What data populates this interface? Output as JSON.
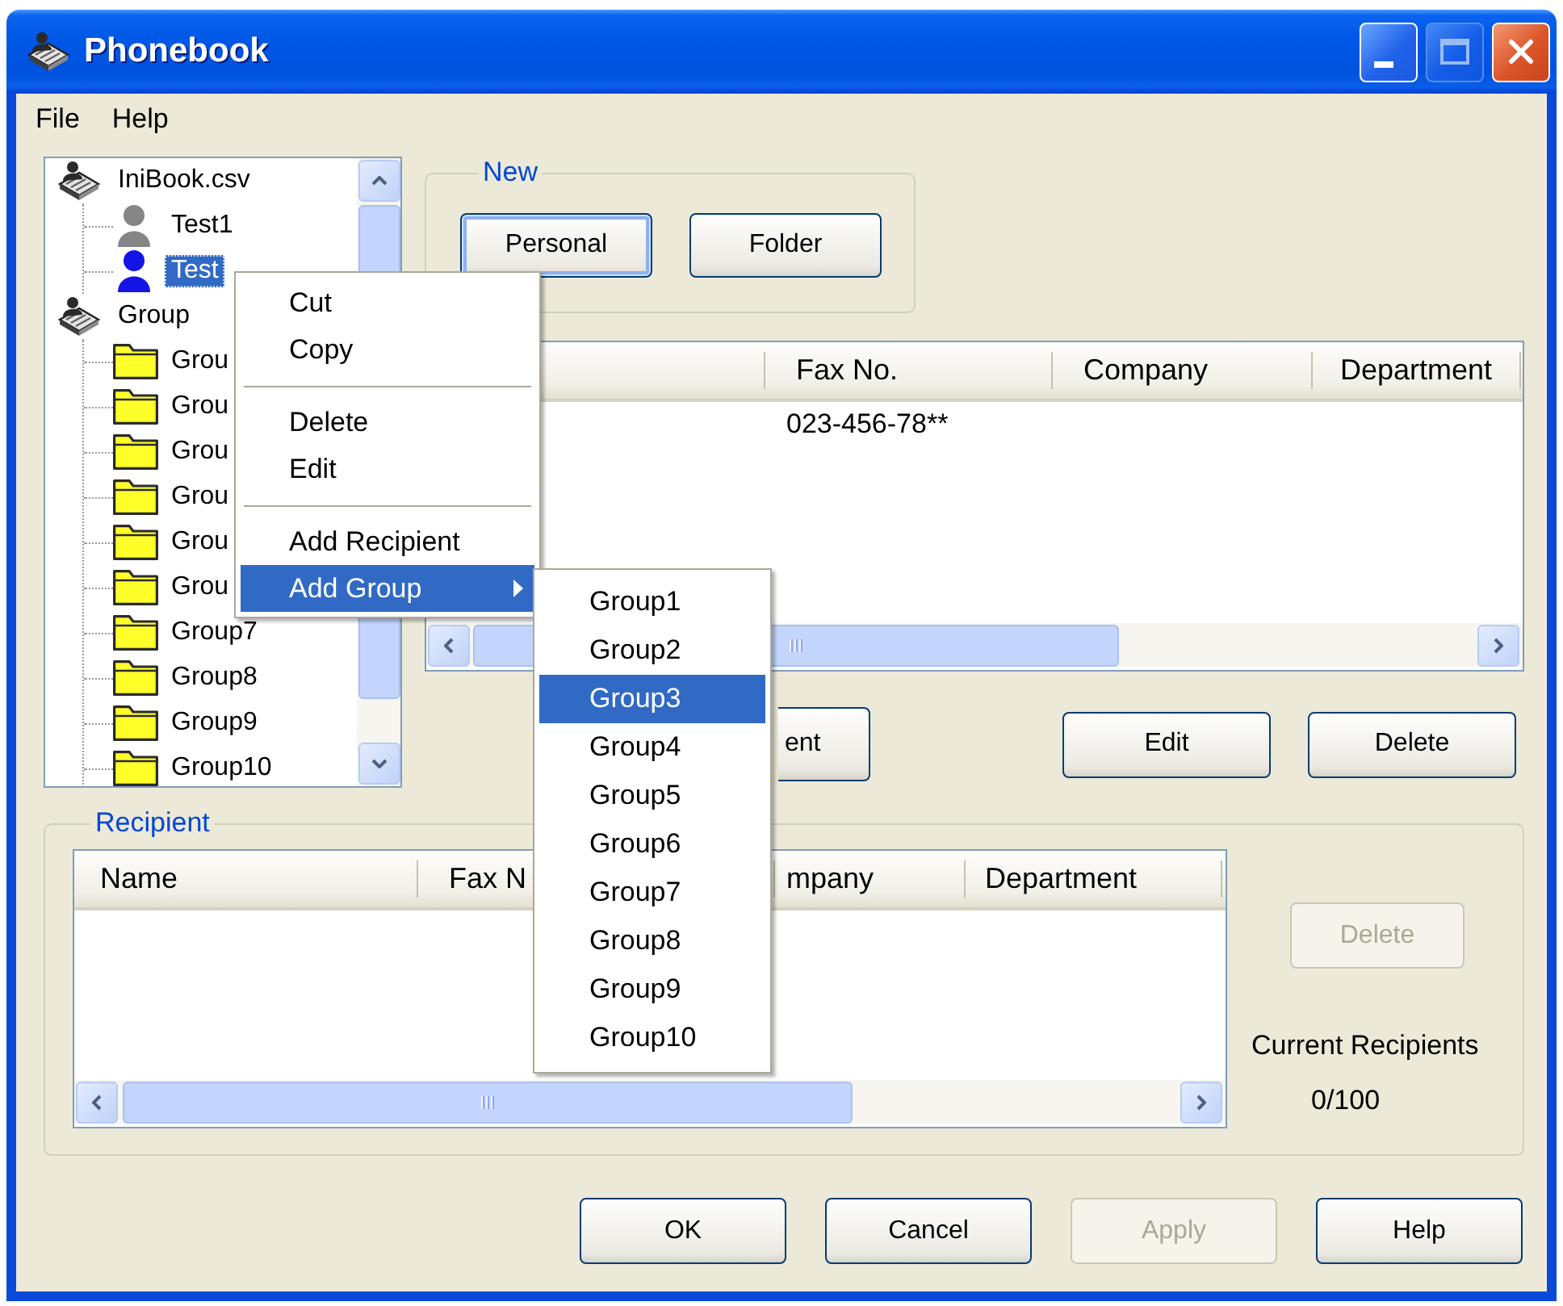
{
  "window": {
    "title": "Phonebook",
    "controls": [
      {
        "kind": "minimize",
        "disabled": false
      },
      {
        "kind": "maximize",
        "disabled": true
      },
      {
        "kind": "close",
        "disabled": false
      }
    ]
  },
  "menu": [
    "File",
    "Help"
  ],
  "tree": {
    "nodes": [
      {
        "kind": "book",
        "label": "IniBook.csv",
        "selected": false,
        "children": [
          {
            "kind": "person",
            "label": "Test1",
            "selected": false
          },
          {
            "kind": "person",
            "label": "Test",
            "selected": true
          }
        ]
      },
      {
        "kind": "book",
        "label": "Group",
        "selected": false,
        "children": [
          {
            "kind": "folder",
            "label": "Grou",
            "selected": false
          },
          {
            "kind": "folder",
            "label": "Grou",
            "selected": false
          },
          {
            "kind": "folder",
            "label": "Grou",
            "selected": false
          },
          {
            "kind": "folder",
            "label": "Grou",
            "selected": false
          },
          {
            "kind": "folder",
            "label": "Grou",
            "selected": false
          },
          {
            "kind": "folder",
            "label": "Grou",
            "selected": false
          },
          {
            "kind": "folder",
            "label": "Group7",
            "selected": false
          },
          {
            "kind": "folder",
            "label": "Group8",
            "selected": false
          },
          {
            "kind": "folder",
            "label": "Group9",
            "selected": false
          },
          {
            "kind": "folder",
            "label": "Group10",
            "selected": false
          }
        ]
      }
    ]
  },
  "new_group": {
    "title": "New",
    "buttons": [
      {
        "label": "Personal",
        "focused": true
      },
      {
        "label": "Folder",
        "focused": false
      }
    ]
  },
  "address_list": {
    "columns": [
      "Fax No.",
      "Company",
      "Department"
    ],
    "rows": [
      {
        "cells": [
          "023-456-78**"
        ]
      }
    ]
  },
  "list_buttons": [
    {
      "label": "ent"
    },
    {
      "label": "Edit"
    },
    {
      "label": "Delete"
    }
  ],
  "recipient": {
    "title": "Recipient",
    "columns": [
      "Name",
      "Fax N",
      "mpany",
      "Department"
    ],
    "delete_button": {
      "label": "Delete",
      "disabled": true
    },
    "count_label": "Current Recipients",
    "count": "0/100"
  },
  "dialog_buttons": [
    {
      "label": "OK",
      "disabled": false
    },
    {
      "label": "Cancel",
      "disabled": false
    },
    {
      "label": "Apply",
      "disabled": true
    },
    {
      "label": "Help",
      "disabled": false
    }
  ],
  "context_menu": {
    "items": [
      {
        "kind": "item",
        "label": "Cut",
        "selected": false
      },
      {
        "kind": "item",
        "label": "Copy",
        "selected": false
      },
      {
        "kind": "separator"
      },
      {
        "kind": "item",
        "label": "Delete",
        "selected": false
      },
      {
        "kind": "item",
        "label": "Edit",
        "selected": false
      },
      {
        "kind": "separator"
      },
      {
        "kind": "item",
        "label": "Add Recipient",
        "selected": false
      },
      {
        "kind": "submenu",
        "label": "Add Group",
        "selected": true,
        "submenu": [
          {
            "label": "Group1",
            "selected": false
          },
          {
            "label": "Group2",
            "selected": false
          },
          {
            "label": "Group3",
            "selected": true
          },
          {
            "label": "Group4",
            "selected": false
          },
          {
            "label": "Group5",
            "selected": false
          },
          {
            "label": "Group6",
            "selected": false
          },
          {
            "label": "Group7",
            "selected": false
          },
          {
            "label": "Group8",
            "selected": false
          },
          {
            "label": "Group9",
            "selected": false
          },
          {
            "label": "Group10",
            "selected": false
          }
        ]
      }
    ]
  }
}
